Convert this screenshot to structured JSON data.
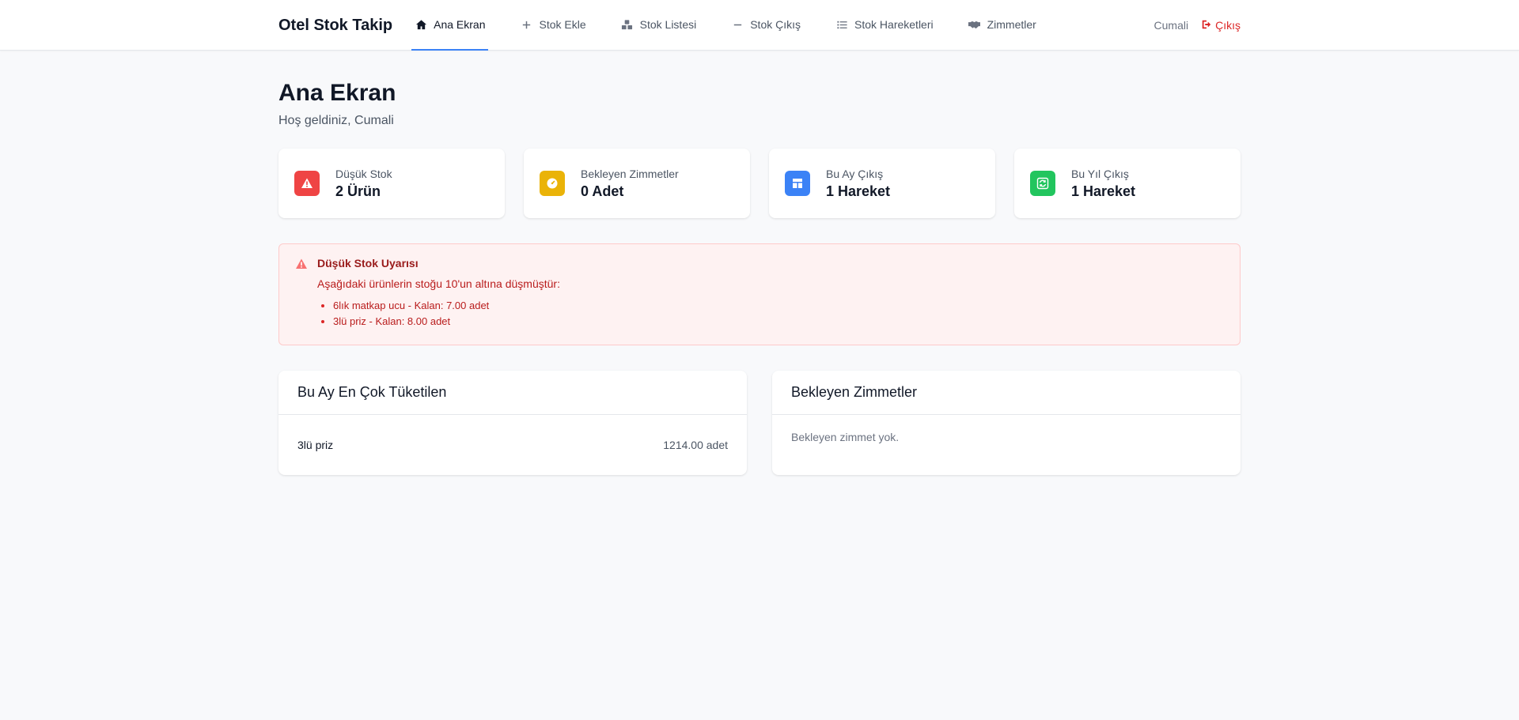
{
  "app": {
    "brand": "Otel Stok Takip"
  },
  "nav": {
    "links": [
      {
        "label": "Ana Ekran",
        "icon": "home-icon"
      },
      {
        "label": "Stok Ekle",
        "icon": "plus-icon"
      },
      {
        "label": "Stok Listesi",
        "icon": "boxes-icon"
      },
      {
        "label": "Stok Çıkış",
        "icon": "minus-icon"
      },
      {
        "label": "Stok Hareketleri",
        "icon": "list-icon"
      },
      {
        "label": "Zimmetler",
        "icon": "handshake-icon"
      }
    ],
    "active": "Ana Ekran",
    "user": "Cumali",
    "logout": "Çıkış"
  },
  "page": {
    "title": "Ana Ekran",
    "subtitle": "Hoş geldiniz, Cumali"
  },
  "stats": [
    {
      "label": "Düşük Stok",
      "value": "2 Ürün",
      "icon": "warning-icon",
      "color": "#ef4444"
    },
    {
      "label": "Bekleyen Zimmetler",
      "value": "0 Adet",
      "icon": "clock-icon",
      "color": "#eab308"
    },
    {
      "label": "Bu Ay Çıkış",
      "value": "1 Hareket",
      "icon": "layout-icon",
      "color": "#3b82f6"
    },
    {
      "label": "Bu Yıl Çıkış",
      "value": "1 Hareket",
      "icon": "refresh-icon",
      "color": "#22c55e"
    }
  ],
  "alert": {
    "title": "Düşük Stok Uyarısı",
    "text": "Aşağıdaki ürünlerin stoğu 10'un altına düşmüştür:",
    "items": [
      "6lık matkap ucu - Kalan: 7.00 adet",
      "3lü priz - Kalan: 8.00 adet"
    ]
  },
  "panels": {
    "consumed": {
      "title": "Bu Ay En Çok Tüketilen",
      "rows": [
        {
          "name": "3lü priz",
          "qty": "1214.00 adet"
        }
      ]
    },
    "pending": {
      "title": "Bekleyen Zimmetler",
      "empty": "Bekleyen zimmet yok."
    }
  }
}
